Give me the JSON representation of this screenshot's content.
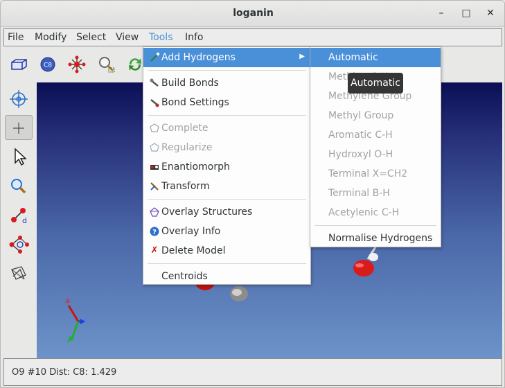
{
  "window": {
    "title": "loganin"
  },
  "menubar": [
    "File",
    "Modify",
    "Select",
    "View",
    "Tools",
    "Info"
  ],
  "tools_menu": {
    "items": [
      {
        "label": "Add Hydrogens",
        "icon": "add-hydrogens-icon",
        "state": "highlighted",
        "submenu": true
      },
      {
        "label": "Build Bonds",
        "icon": "build-bonds-icon",
        "state": "enabled"
      },
      {
        "label": "Bond Settings",
        "icon": "bond-settings-icon",
        "state": "enabled"
      },
      {
        "label": "Complete",
        "icon": "complete-icon",
        "state": "disabled"
      },
      {
        "label": "Regularize",
        "icon": "regularize-icon",
        "state": "disabled"
      },
      {
        "label": "Enantiomorph",
        "icon": "enantiomorph-icon",
        "state": "enabled"
      },
      {
        "label": "Transform",
        "icon": "transform-icon",
        "state": "enabled"
      },
      {
        "label": "Overlay Structures",
        "icon": "overlay-structures-icon",
        "state": "enabled"
      },
      {
        "label": "Overlay Info",
        "icon": "info-icon",
        "state": "enabled"
      },
      {
        "label": "Delete Model",
        "icon": "delete-icon",
        "state": "enabled"
      },
      {
        "label": "Centroids",
        "icon": "",
        "state": "enabled"
      }
    ]
  },
  "hydrogens_submenu": {
    "items": [
      {
        "label": "Automatic",
        "state": "highlighted"
      },
      {
        "label": "Methine C-H",
        "state": "disabled"
      },
      {
        "label": "Methylene Group",
        "state": "disabled"
      },
      {
        "label": "Methyl Group",
        "state": "disabled"
      },
      {
        "label": "Aromatic C-H",
        "state": "disabled"
      },
      {
        "label": "Hydroxyl O-H",
        "state": "disabled"
      },
      {
        "label": "Terminal X=CH2",
        "state": "disabled"
      },
      {
        "label": "Terminal B-H",
        "state": "disabled"
      },
      {
        "label": "Acetylenic C-H",
        "state": "disabled"
      },
      {
        "label": "Normalise Hydrogens",
        "state": "enabled"
      }
    ]
  },
  "tooltip": "Automatic",
  "axes": {
    "a": "a",
    "c": "c"
  },
  "toolbar_icons": {
    "c8": "C8",
    "d": "d"
  },
  "status": "O9 #10 Dist: C8: 1.429",
  "colors": {
    "highlight": "#4a90d9",
    "oxygen": "#d81c1c",
    "carbon": "#9a9a9a"
  }
}
